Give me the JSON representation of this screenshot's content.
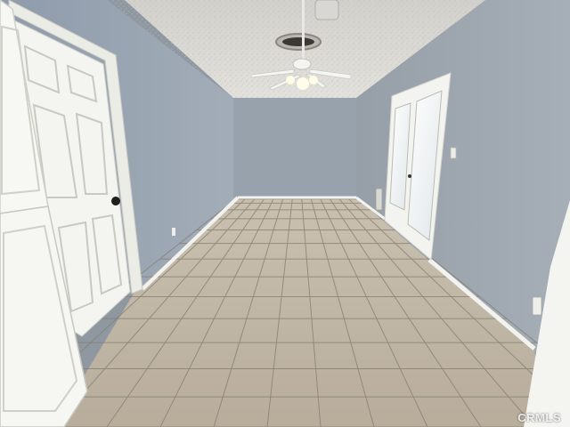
{
  "watermark": {
    "text": "CRMLS"
  },
  "colors": {
    "ceiling": "#d9d7d2",
    "wall_left": "#9aa6b3",
    "wall_back": "#98a2ad",
    "wall_right": "#a4adb6",
    "floor_tile": "#c3b8a6",
    "grout": "#857c70",
    "trim": "#f2f2ee",
    "door": "#f4f4f0"
  },
  "icons": [
    "ceiling-fan-icon",
    "air-vent-icon",
    "door-knob-icon",
    "wall-outlet-icon"
  ]
}
